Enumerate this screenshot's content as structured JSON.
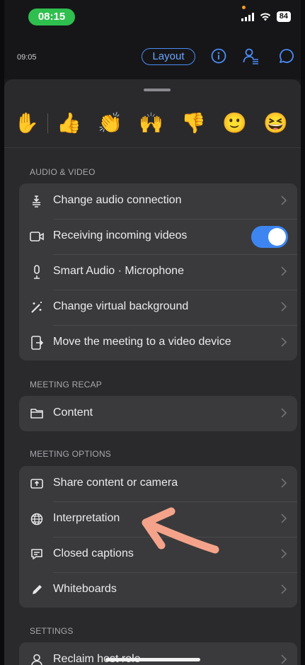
{
  "status_bar": {
    "time": "08:15",
    "battery": "84"
  },
  "header": {
    "elapsed": "09:05",
    "layout_label": "Layout"
  },
  "reactions": [
    "✋",
    "👍",
    "👏",
    "🙌",
    "👎",
    "🙂",
    "😆"
  ],
  "sections": {
    "audio_video": {
      "title": "AUDIO & VIDEO",
      "rows": [
        {
          "label": "Change audio connection",
          "icon": "audio-connection-icon"
        },
        {
          "label": "Receiving incoming videos",
          "icon": "video-camera-icon",
          "toggle": true
        },
        {
          "label": "Smart Audio · Microphone",
          "icon": "microphone-icon"
        },
        {
          "label": "Change virtual background",
          "icon": "magic-wand-icon"
        },
        {
          "label": "Move the meeting to a video device",
          "icon": "move-device-icon"
        }
      ]
    },
    "meeting_recap": {
      "title": "MEETING RECAP",
      "rows": [
        {
          "label": "Content",
          "icon": "folder-icon"
        }
      ]
    },
    "meeting_options": {
      "title": "MEETING OPTIONS",
      "rows": [
        {
          "label": "Share content or camera",
          "icon": "share-screen-icon"
        },
        {
          "label": "Interpretation",
          "icon": "globe-icon"
        },
        {
          "label": "Closed captions",
          "icon": "captions-icon"
        },
        {
          "label": "Whiteboards",
          "icon": "pen-icon"
        }
      ]
    },
    "settings": {
      "title": "SETTINGS",
      "rows": [
        {
          "label": "Reclaim host role",
          "icon": "person-icon"
        }
      ]
    }
  },
  "colors": {
    "accent": "#3d86f2",
    "annotation_arrow": "#f4a38a",
    "time_pill": "#2fbf4f"
  }
}
